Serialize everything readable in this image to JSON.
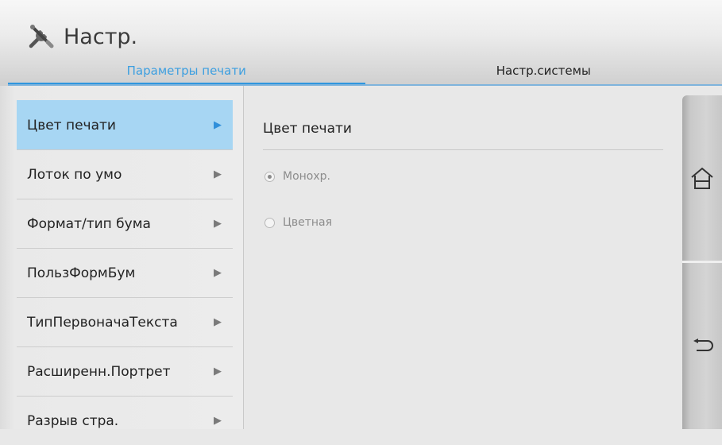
{
  "header": {
    "title": "Настр.",
    "icon": "settings-tools-icon"
  },
  "tabs": [
    {
      "label": "Параметры печати",
      "active": true
    },
    {
      "label": "Настр.системы",
      "active": false
    }
  ],
  "menu": {
    "items": [
      {
        "label": "Цвет печати",
        "selected": true
      },
      {
        "label": "Лоток по умо",
        "selected": false
      },
      {
        "label": "Формат/тип бума",
        "selected": false
      },
      {
        "label": "ПользФормБум",
        "selected": false
      },
      {
        "label": "ТипПервоначаТекста",
        "selected": false
      },
      {
        "label": "Расширенн.Портрет",
        "selected": false
      },
      {
        "label": "Разрыв стра.",
        "selected": false
      }
    ],
    "arrow": "▶"
  },
  "content": {
    "title": "Цвет печати",
    "options": [
      {
        "label": "Монохр.",
        "checked": true
      },
      {
        "label": "Цветная",
        "checked": false
      }
    ]
  },
  "nav": {
    "home_icon": "home-icon",
    "back_icon": "back-icon"
  },
  "colors": {
    "accent": "#2f96de",
    "selected_bg": "#a7d6f3"
  }
}
